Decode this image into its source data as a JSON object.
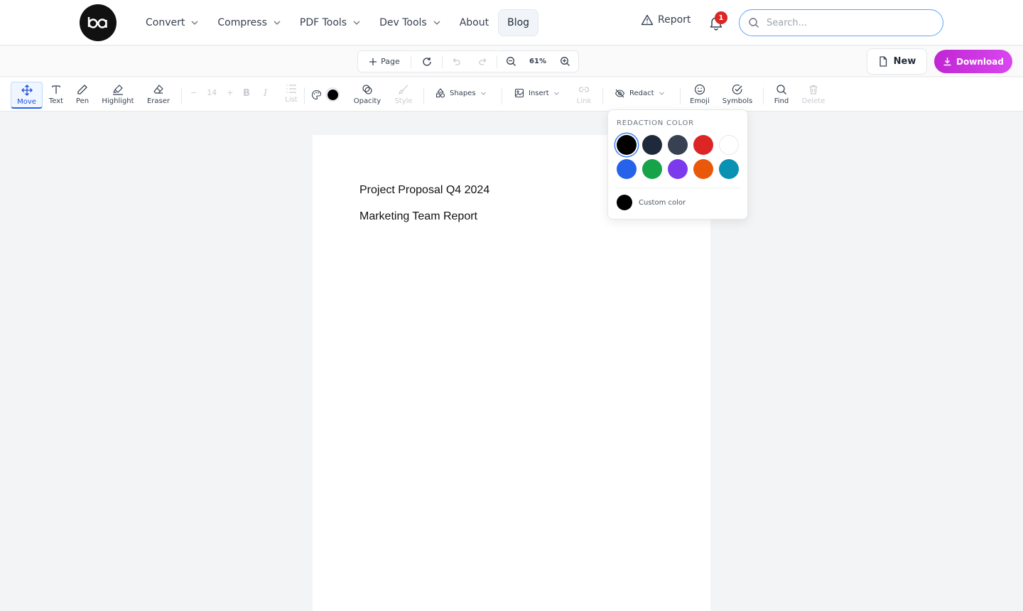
{
  "nav": {
    "items": [
      {
        "label": "Convert",
        "dropdown": true
      },
      {
        "label": "Compress",
        "dropdown": true
      },
      {
        "label": "PDF Tools",
        "dropdown": true
      },
      {
        "label": "Dev Tools",
        "dropdown": true
      },
      {
        "label": "About",
        "dropdown": false
      },
      {
        "label": "Blog",
        "dropdown": false,
        "active": true
      }
    ],
    "report_label": "Report",
    "notification_count": "1",
    "search_placeholder": "Search..."
  },
  "pagebar": {
    "add_page_label": "Page",
    "zoom": "61%",
    "new_label": "New",
    "download_label": "Download"
  },
  "toolbar": {
    "move": "Move",
    "text": "Text",
    "pen": "Pen",
    "highlight": "Highlight",
    "eraser": "Eraser",
    "font_size": "14",
    "list": "List",
    "opacity": "Opacity",
    "style": "Style",
    "shapes": "Shapes",
    "insert": "Insert",
    "link": "Link",
    "redact": "Redact",
    "emoji": "Emoji",
    "symbols": "Symbols",
    "find": "Find",
    "delete": "Delete",
    "current_color": "#000000"
  },
  "document": {
    "line1": "Project Proposal Q4 2024",
    "line2": "Marketing Team Report"
  },
  "redaction_popover": {
    "title": "REDACTION COLOR",
    "colors": [
      "#000000",
      "#1e293b",
      "#374151",
      "#dc2626",
      "#ffffff",
      "#2563eb",
      "#16a34a",
      "#7c3aed",
      "#ea580c",
      "#0891b2"
    ],
    "selected": "#000000",
    "custom_label": "Custom color"
  }
}
